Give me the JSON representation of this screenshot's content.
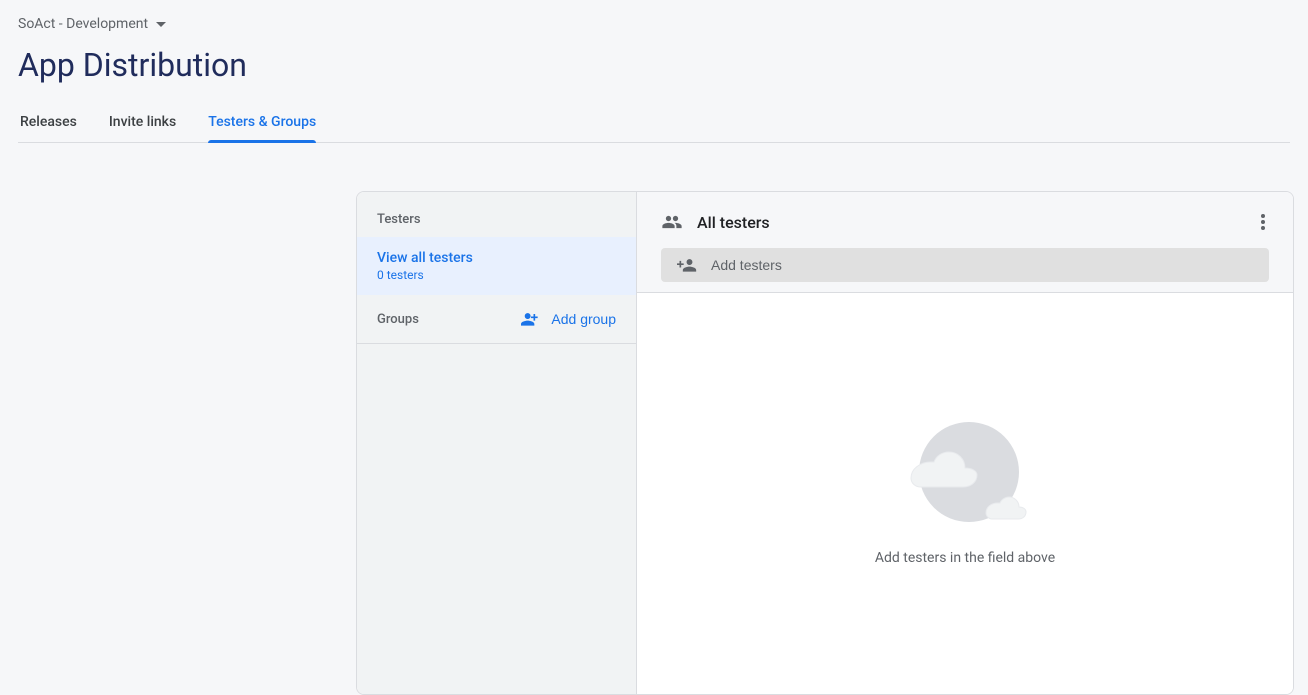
{
  "header": {
    "project_name": "SoAct - Development",
    "page_title": "App Distribution"
  },
  "tabs": [
    {
      "label": "Releases",
      "active": false
    },
    {
      "label": "Invite links",
      "active": false
    },
    {
      "label": "Testers & Groups",
      "active": true
    }
  ],
  "sidebar": {
    "testers_label": "Testers",
    "view_all": {
      "title": "View all testers",
      "subtitle": "0 testers"
    },
    "groups_label": "Groups",
    "add_group_label": "Add group"
  },
  "main": {
    "title": "All testers",
    "add_testers_placeholder": "Add testers",
    "empty_text": "Add testers in the field above"
  }
}
